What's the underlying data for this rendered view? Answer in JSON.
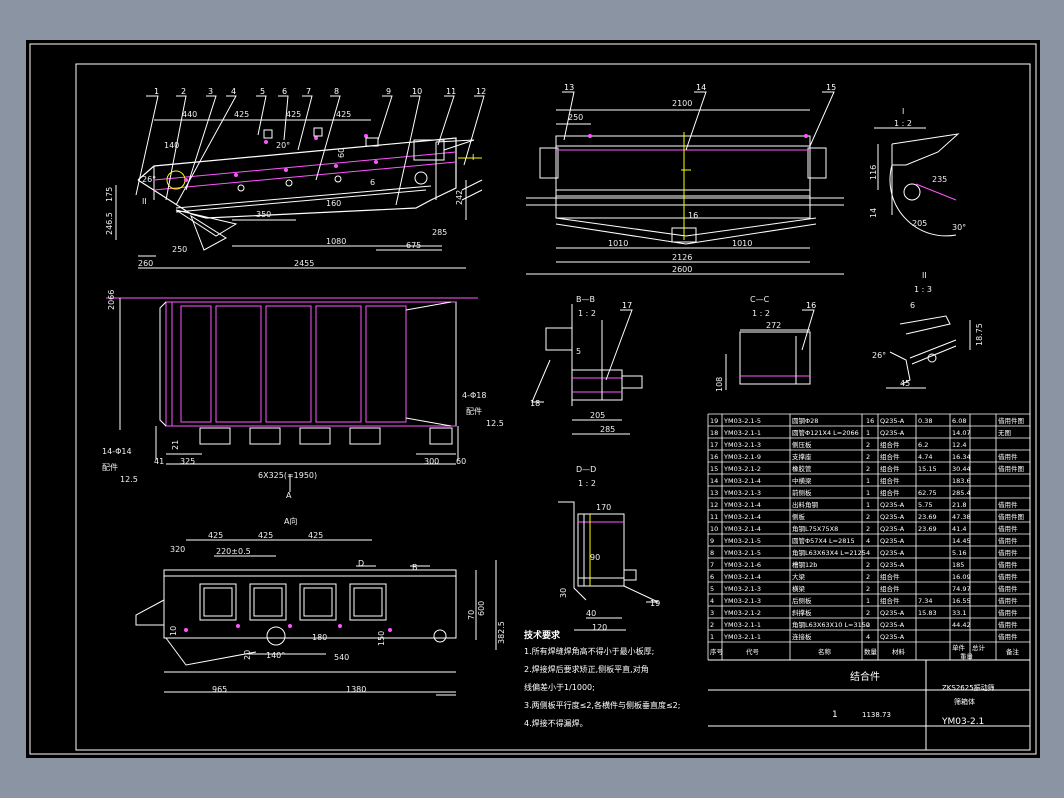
{
  "drawing": {
    "title_block": {
      "assembly_label": "结合件",
      "scale": "1",
      "weight": "1138.73",
      "project": "ZKS2625振动筛",
      "part": "筛箱体",
      "drawing_no": "YM03-2.1"
    },
    "view_labels": {
      "a_dir": "A向",
      "a_mark": "A",
      "section_bb": "B—B",
      "section_cc": "C—C",
      "section_dd": "D—D",
      "ratio_12": "1 : 2",
      "detail_1": "I",
      "detail_1_ratio": "1 : 2",
      "detail_2": "II",
      "detail_2_ratio": "1 : 3"
    },
    "tech_notes": {
      "title": "技术要求",
      "items": [
        "1.所有焊缝焊角高不得小于最小板厚;",
        "2.焊接焊后要求矫正,侧板平直,对角",
        "   线偏差小于1/1000;",
        "3.两侧板平行度≤2,各横件与侧板垂直度≤2;",
        "4.焊接不得漏焊。"
      ]
    },
    "balloons": [
      "1",
      "2",
      "3",
      "4",
      "5",
      "6",
      "7",
      "8",
      "9",
      "10",
      "11",
      "12",
      "13",
      "14",
      "15",
      "16",
      "17",
      "18",
      "19"
    ],
    "dims_top": {
      "d440": "440",
      "d425a": "425",
      "d425b": "425",
      "d425c": "425",
      "d140": "140",
      "d26": "26°",
      "d20": "20°",
      "d60": "60",
      "d350": "350",
      "d1080": "1080",
      "d675": "675",
      "d250": "250",
      "d260": "260",
      "d2455": "2455",
      "d285": "285",
      "d242": "242",
      "d246": "246.5",
      "d175": "175",
      "d6": "6",
      "d160": "160",
      "I": "I",
      "II": "II"
    },
    "dims_side": {
      "d250": "250",
      "d2100": "2100",
      "d1010a": "1010",
      "d1010b": "1010",
      "d2126": "2126",
      "d2600": "2600",
      "d16": "16"
    },
    "dims_plan": {
      "d2066": "2066",
      "d14_018": "4-Φ18",
      "d12_5a": "12.5",
      "d14_014": "14-Φ14",
      "d12_5b": "12.5",
      "pj1": "配件",
      "pj2": "配件",
      "d41": "41",
      "d325": "325",
      "d6x325": "6X325(=1950)",
      "d300": "300",
      "d60": "60",
      "d21": "21"
    },
    "dims_a": {
      "d320": "320",
      "d425a": "425",
      "d425b": "425",
      "d425c": "425",
      "d220": "220±0.5",
      "d10": "10",
      "d20": "20",
      "d180": "180",
      "d540": "540",
      "d150": "150",
      "d140": "140°",
      "d965": "965",
      "d1380": "1380",
      "d70": "70",
      "d600": "600",
      "d382": "382.5",
      "D": "D",
      "B": "B"
    },
    "dims_bb": {
      "d5": "5",
      "d205": "205",
      "d285": "285"
    },
    "dims_cc": {
      "d272": "272",
      "d108": "108"
    },
    "dims_dd": {
      "d170": "170",
      "d90": "90",
      "d30": "30",
      "d40": "40",
      "d120": "120"
    },
    "dims_det1": {
      "d116": "116",
      "d235": "235",
      "d205": "205",
      "d30": "30°",
      "d14": "14"
    },
    "dims_det2": {
      "d6": "6",
      "d26": "26°",
      "d45": "45",
      "d18": "18.75"
    },
    "bom": {
      "header": [
        "序号",
        "代号",
        "名称",
        "数量",
        "材料",
        "单件",
        "总计",
        "重量",
        "备注"
      ],
      "rows": [
        [
          "19",
          "YM03-2.1-5",
          "圆钢Φ28",
          "16",
          "Q235-A",
          "0.38",
          "6.08",
          "借用件图"
        ],
        [
          "18",
          "YM03-2.1-1",
          "圆管Φ121X4 L=2066",
          "1",
          "Q235-A",
          "",
          "14.07",
          "无图"
        ],
        [
          "17",
          "YM03-2.1-3",
          "侧压板",
          "2",
          "组合件",
          "6.2",
          "12.4",
          ""
        ],
        [
          "16",
          "YM03-2.1-9",
          "支撑座",
          "2",
          "组合件",
          "4.74",
          "16.34",
          "借用件"
        ],
        [
          "15",
          "YM03-2.1-2",
          "橡胶管",
          "2",
          "组合件",
          "15.15",
          "30.44",
          "借用件图"
        ],
        [
          "14",
          "YM03-2.1-4",
          "中横梁",
          "1",
          "组合件",
          "",
          "183.6",
          ""
        ],
        [
          "13",
          "YM03-2.1-3",
          "前侧板",
          "1",
          "组合件",
          "62.75",
          "285.4",
          ""
        ],
        [
          "12",
          "YM03-2.1-4",
          "出料角钢",
          "1",
          "Q235-A",
          "5.75",
          "21.8",
          "借用件"
        ],
        [
          "11",
          "YM03-2.1-4",
          "侧板",
          "2",
          "Q235-A",
          "23.69",
          "47.38",
          "借用件图"
        ],
        [
          "10",
          "YM03-2.1-4",
          "角钢L75X75X8",
          "2",
          "Q235-A",
          "23.69",
          "41.4",
          "借用件"
        ],
        [
          "9",
          "YM03-2.1-5",
          "圆管Φ57X4 L=2815",
          "4",
          "Q235-A",
          "",
          "14.45",
          "借用件"
        ],
        [
          "8",
          "YM03-2.1-5",
          "角钢L63X63X4 L=2125",
          "4",
          "Q235-A",
          "",
          "5.16",
          "借用件"
        ],
        [
          "7",
          "YM03-2.1-6",
          "槽钢12b",
          "2",
          "Q235-A",
          "",
          "185",
          "借用件"
        ],
        [
          "6",
          "YM03-2.1-4",
          "大梁",
          "2",
          "组合件",
          "",
          "16.09",
          "借用件"
        ],
        [
          "5",
          "YM03-2.1-3",
          "横梁",
          "2",
          "组合件",
          "",
          "74.97",
          "借用件"
        ],
        [
          "4",
          "YM03-2.1-3",
          "后侧板",
          "1",
          "组合件",
          "7.34",
          "16.55",
          "借用件"
        ],
        [
          "3",
          "YM03-2.1-2",
          "斜撑板",
          "2",
          "Q235-A",
          "15.83",
          "33.1",
          "借用件"
        ],
        [
          "2",
          "YM03-2.1-1",
          "角钢L63X63X10 L=3150",
          "2",
          "Q235-A",
          "",
          "44.42",
          "借用件"
        ],
        [
          "1",
          "YM03-2.1-1",
          "连接板",
          "4",
          "Q235-A",
          "",
          "",
          "借用件"
        ]
      ]
    }
  }
}
